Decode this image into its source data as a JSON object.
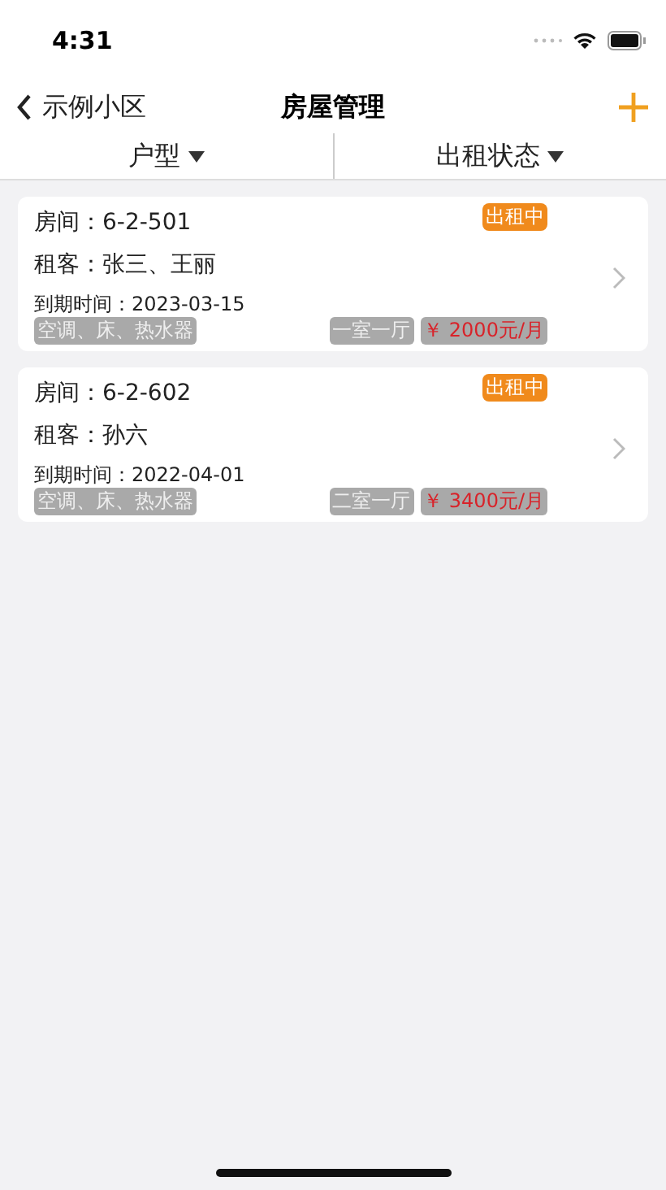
{
  "status_bar": {
    "time": "4:31"
  },
  "nav": {
    "back_label": "示例小区",
    "title": "房屋管理"
  },
  "filters": [
    {
      "label": "户型"
    },
    {
      "label": "出租状态"
    }
  ],
  "rooms": [
    {
      "room": "房间：6-2-501",
      "tenants": "租客：张三、王丽",
      "expiry": "到期时间：2023-03-15",
      "status": "出租中",
      "facilities": "空调、床、热水器",
      "layout": "一室一厅",
      "rent": "￥ 2000元/月"
    },
    {
      "room": "房间：6-2-602",
      "tenants": "租客：孙六",
      "expiry": "到期时间：2022-04-01",
      "status": "出租中",
      "facilities": "空调、床、热水器",
      "layout": "二室一厅",
      "rent": "￥ 3400元/月"
    }
  ]
}
